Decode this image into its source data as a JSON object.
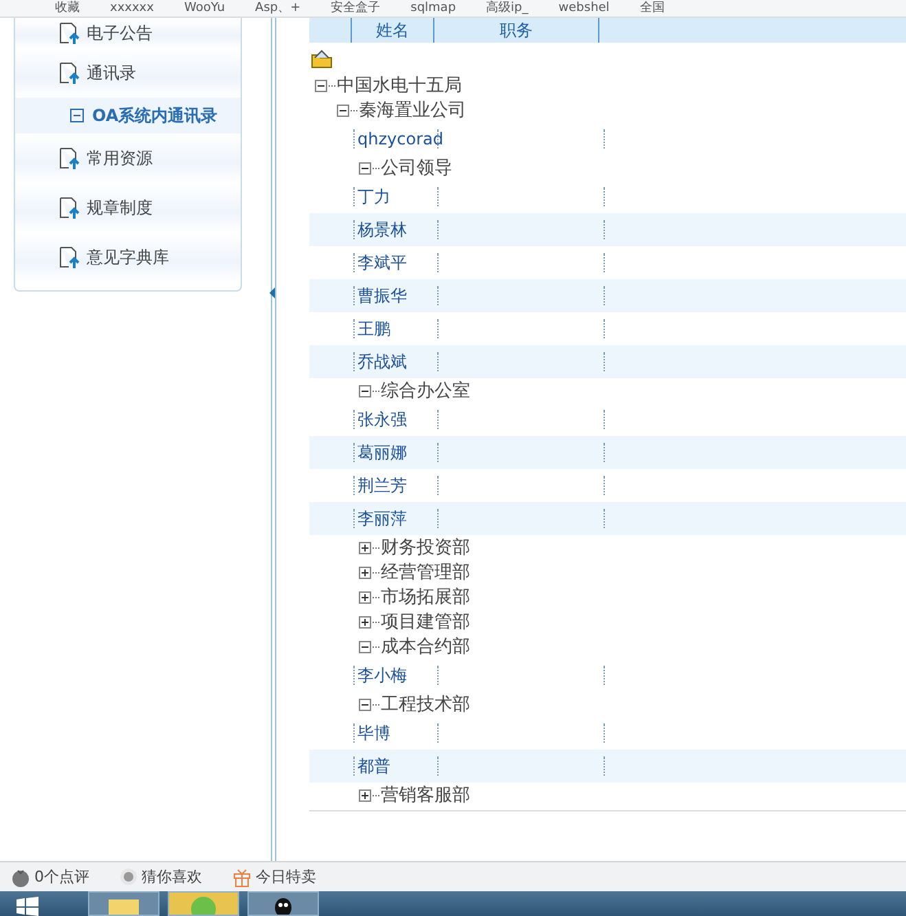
{
  "bookmarks": [
    {
      "label": "收藏"
    },
    {
      "label": "xxxxxx"
    },
    {
      "label": "WooYu"
    },
    {
      "label": "Asp、+"
    },
    {
      "label": "安全盒子"
    },
    {
      "label": "sqlmap"
    },
    {
      "label": "高级ip_"
    },
    {
      "label": "webshel"
    },
    {
      "label": "全国"
    }
  ],
  "sidebar": {
    "items": [
      {
        "label": "电子公告"
      },
      {
        "label": "通讯录",
        "children": [
          {
            "label": "OA系统内通讯录",
            "selected": true
          }
        ]
      },
      {
        "label": "常用资源"
      },
      {
        "label": "规章制度"
      },
      {
        "label": "意见字典库"
      }
    ]
  },
  "table": {
    "columns": [
      "姓名",
      "职务"
    ],
    "tree": [
      {
        "kind": "group",
        "label": "中国水电十五局",
        "expanded": true,
        "children": [
          {
            "kind": "group",
            "label": "秦海置业公司",
            "expanded": true,
            "children": [
              {
                "kind": "person",
                "name": "qhzycorad"
              },
              {
                "kind": "group",
                "label": "公司领导",
                "expanded": true,
                "children": [
                  {
                    "kind": "person",
                    "name": "丁力"
                  },
                  {
                    "kind": "person",
                    "name": "杨景林"
                  },
                  {
                    "kind": "person",
                    "name": "李斌平"
                  },
                  {
                    "kind": "person",
                    "name": "曹振华"
                  },
                  {
                    "kind": "person",
                    "name": "王鹏"
                  },
                  {
                    "kind": "person",
                    "name": "乔战斌"
                  }
                ]
              },
              {
                "kind": "group",
                "label": "综合办公室",
                "expanded": true,
                "children": [
                  {
                    "kind": "person",
                    "name": "张永强"
                  },
                  {
                    "kind": "person",
                    "name": "葛丽娜"
                  },
                  {
                    "kind": "person",
                    "name": "荆兰芳"
                  },
                  {
                    "kind": "person",
                    "name": "李丽萍"
                  }
                ]
              },
              {
                "kind": "group",
                "label": "财务投资部",
                "expanded": false
              },
              {
                "kind": "group",
                "label": "经营管理部",
                "expanded": false
              },
              {
                "kind": "group",
                "label": "市场拓展部",
                "expanded": false
              },
              {
                "kind": "group",
                "label": "项目建管部",
                "expanded": false
              },
              {
                "kind": "group",
                "label": "成本合约部",
                "expanded": true,
                "children": [
                  {
                    "kind": "person",
                    "name": "李小梅"
                  }
                ]
              },
              {
                "kind": "group",
                "label": "工程技术部",
                "expanded": true,
                "children": [
                  {
                    "kind": "person",
                    "name": "毕博"
                  },
                  {
                    "kind": "person",
                    "name": "都普"
                  }
                ]
              },
              {
                "kind": "group",
                "label": "营销客服部",
                "expanded": false
              }
            ]
          }
        ]
      }
    ]
  },
  "status_bar": [
    {
      "kind": "comments",
      "label": "0个点评"
    },
    {
      "kind": "likes",
      "label": "猜你喜欢"
    },
    {
      "kind": "sale",
      "label": "今日特卖"
    }
  ]
}
